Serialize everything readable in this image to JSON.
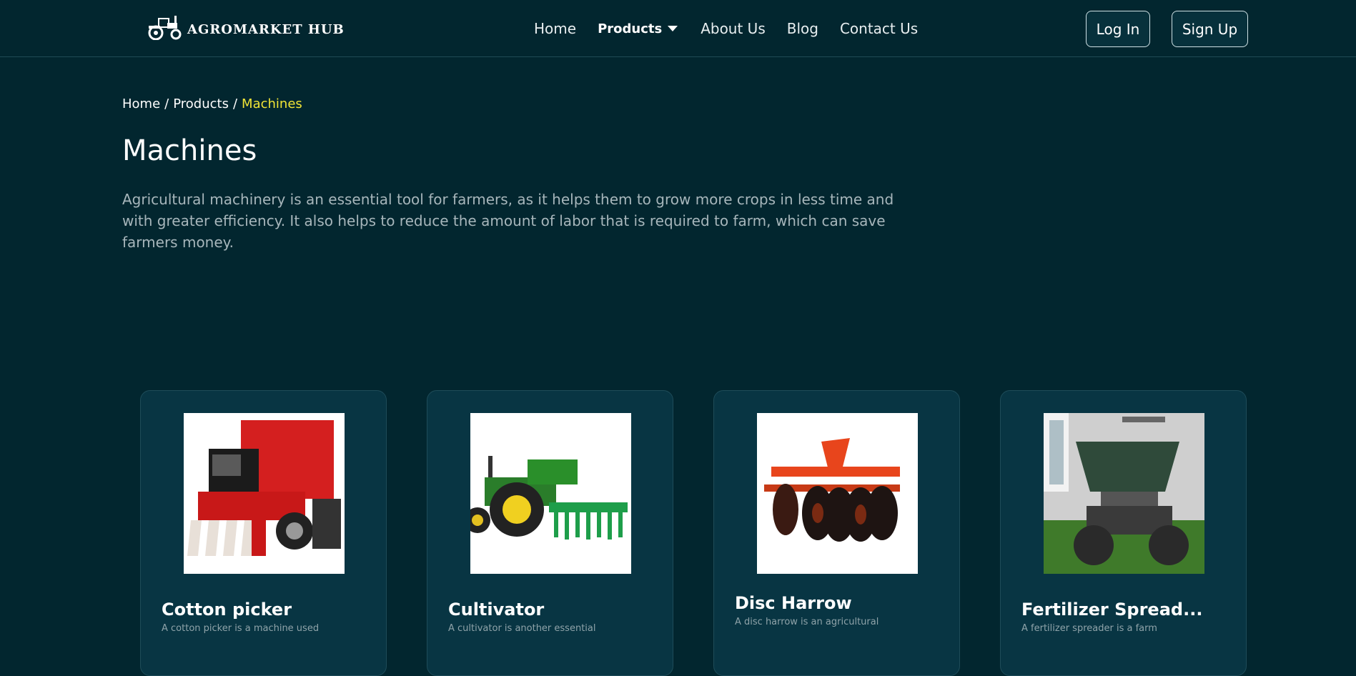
{
  "brand": {
    "name": "AGROMARKET HUB"
  },
  "nav": {
    "home": "Home",
    "products": "Products",
    "about": "About Us",
    "blog": "Blog",
    "contact": "Contact Us"
  },
  "auth": {
    "login": "Log In",
    "signup": "Sign Up"
  },
  "breadcrumb": {
    "home": "Home",
    "products": "Products",
    "current": "Machines",
    "separator": "/"
  },
  "page": {
    "title": "Machines",
    "description": "Agricultural machinery is an essential tool for farmers, as it helps them to grow more crops in less time and with greater efficiency. It also helps to reduce the amount of labor that is required to farm, which can save farmers money."
  },
  "cards": [
    {
      "title": "Cotton picker",
      "description": "A cotton picker is a machine used",
      "image_icon": "cotton-picker-image"
    },
    {
      "title": "Cultivator",
      "description": "A cultivator is another essential",
      "image_icon": "cultivator-image"
    },
    {
      "title": "Disc Harrow",
      "description": "A disc harrow is an agricultural",
      "image_icon": "disc-harrow-image"
    },
    {
      "title": "Fertilizer Spread...",
      "description": "A fertilizer spreader is a farm",
      "image_icon": "fertilizer-spreader-image"
    }
  ],
  "colors": {
    "background": "#02262f",
    "card": "#083543",
    "breadcrumb_active": "#f2e536",
    "muted_text": "#a7b6bb"
  }
}
